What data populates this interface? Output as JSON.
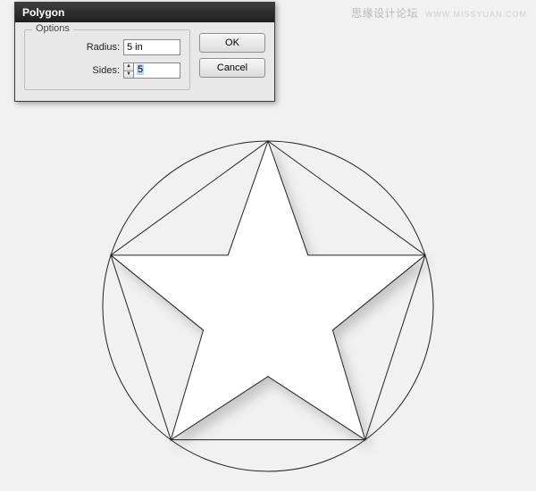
{
  "dialog": {
    "title": "Polygon",
    "options_legend": "Options",
    "radius_label": "Radius:",
    "radius_value": "5 in",
    "sides_label": "Sides:",
    "sides_value": "5",
    "ok_label": "OK",
    "cancel_label": "Cancel"
  },
  "watermark": {
    "text": "思缘设计论坛",
    "url": "WWW.MISSYUAN.COM"
  },
  "chart_data": {
    "type": "diagram",
    "shapes": [
      {
        "kind": "circle",
        "radius_in": 5
      },
      {
        "kind": "regular-polygon",
        "sides": 5,
        "radius_in": 5
      },
      {
        "kind": "star",
        "points": 5,
        "outer_radius_in": 5,
        "fill": "#ffffff"
      }
    ],
    "description": "Pentagon inscribed in circle with white 5-point star and drop shadow"
  }
}
